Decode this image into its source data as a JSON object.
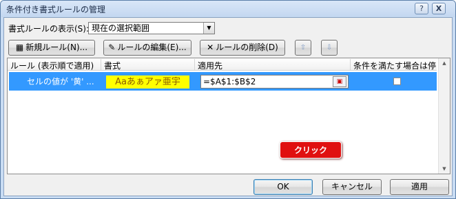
{
  "window": {
    "title": "条件付き書式ルールの管理",
    "help_label": "?",
    "close_label": "X"
  },
  "scope": {
    "label": "書式ルールの表示(S):",
    "value": "現在の選択範囲"
  },
  "toolbar": {
    "new_rule": "新規ルール(N)...",
    "edit_rule": "ルールの編集(E)...",
    "delete_rule": "ルールの削除(D)",
    "move_up": "⇧",
    "move_down": "⇩"
  },
  "grid": {
    "columns": [
      "ルール (表示順で適用)",
      "書式",
      "適用先",
      "条件を満たす場合は停止"
    ],
    "rows": [
      {
        "rule": "セルの値が '黄' ...",
        "format_preview": "Aaあぁアァ亜宇",
        "applies_to": "=$A$1:$B$2",
        "stop_if_true": false
      }
    ]
  },
  "footer": {
    "ok": "OK",
    "cancel": "キャンセル",
    "apply": "適用"
  },
  "annotation": {
    "text": "クリック",
    "color": "#e01010"
  }
}
